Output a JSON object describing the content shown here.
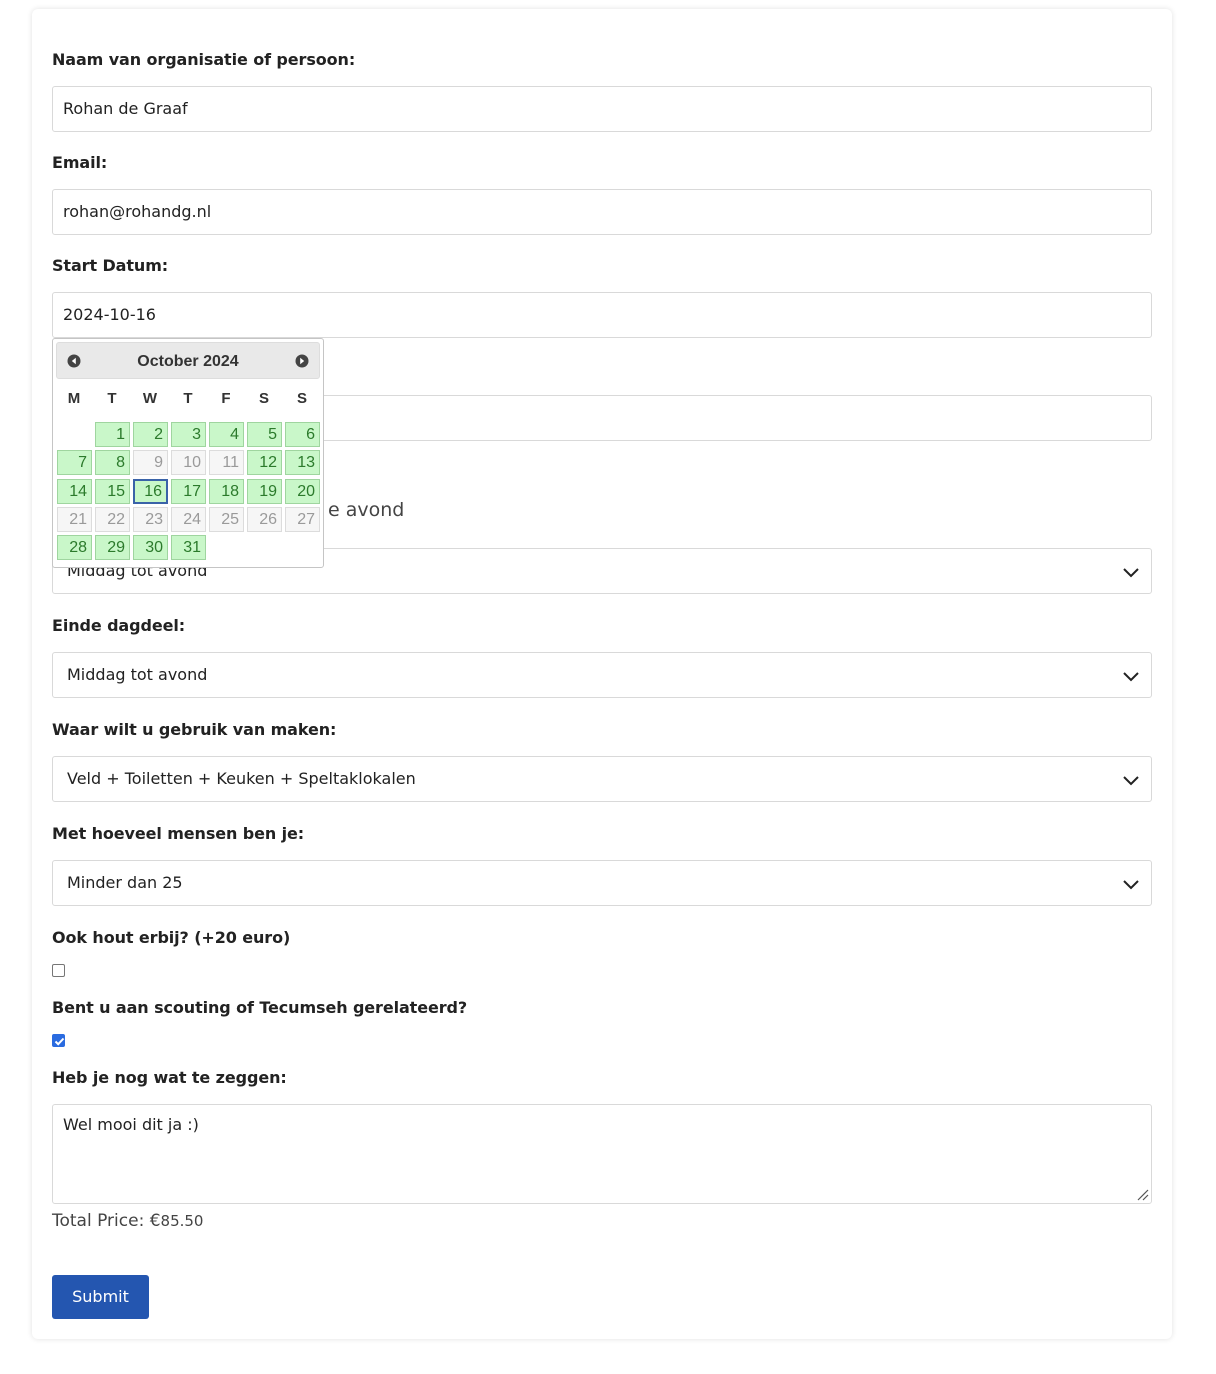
{
  "form": {
    "name_label": "Naam van organisatie of persoon:",
    "name_value": "Rohan de Graaf",
    "email_label": "Email:",
    "email_value": "rohan@rohandg.nl",
    "start_date_label": "Start Datum:",
    "start_date_value": "2024-10-16",
    "behind_text": "e avond",
    "start_part_value": "Middag tot avond",
    "end_part_label": "Einde dagdeel:",
    "end_part_value": "Middag tot avond",
    "usage_label": "Waar wilt u gebruik van maken:",
    "usage_value": "Veld + Toiletten + Keuken + Speltaklokalen",
    "people_label": "Met hoeveel mensen ben je:",
    "people_value": "Minder dan 25",
    "wood_label": "Ook hout erbij? (+20 euro)",
    "wood_checked": false,
    "scouting_label": "Bent u aan scouting of Tecumseh gerelateerd?",
    "scouting_checked": true,
    "comment_label": "Heb je nog wat te zeggen:",
    "comment_value": "Wel mooi dit ja :)",
    "price_label": "Total Price: €",
    "price_value": "85.50",
    "submit_label": "Submit"
  },
  "datepicker": {
    "title": "October 2024",
    "weekdays": [
      "M",
      "T",
      "W",
      "T",
      "F",
      "S",
      "S"
    ],
    "first_weekday_offset": 1,
    "days": [
      {
        "d": "1",
        "s": "avail"
      },
      {
        "d": "2",
        "s": "avail"
      },
      {
        "d": "3",
        "s": "avail"
      },
      {
        "d": "4",
        "s": "avail"
      },
      {
        "d": "5",
        "s": "avail"
      },
      {
        "d": "6",
        "s": "avail"
      },
      {
        "d": "7",
        "s": "avail"
      },
      {
        "d": "8",
        "s": "avail"
      },
      {
        "d": "9",
        "s": "unavail"
      },
      {
        "d": "10",
        "s": "unavail"
      },
      {
        "d": "11",
        "s": "unavail"
      },
      {
        "d": "12",
        "s": "avail"
      },
      {
        "d": "13",
        "s": "avail"
      },
      {
        "d": "14",
        "s": "avail"
      },
      {
        "d": "15",
        "s": "avail"
      },
      {
        "d": "16",
        "s": "selected"
      },
      {
        "d": "17",
        "s": "avail"
      },
      {
        "d": "18",
        "s": "avail"
      },
      {
        "d": "19",
        "s": "avail"
      },
      {
        "d": "20",
        "s": "avail"
      },
      {
        "d": "21",
        "s": "unavail"
      },
      {
        "d": "22",
        "s": "unavail"
      },
      {
        "d": "23",
        "s": "unavail"
      },
      {
        "d": "24",
        "s": "unavail"
      },
      {
        "d": "25",
        "s": "unavail"
      },
      {
        "d": "26",
        "s": "unavail"
      },
      {
        "d": "27",
        "s": "unavail"
      },
      {
        "d": "28",
        "s": "avail"
      },
      {
        "d": "29",
        "s": "avail"
      },
      {
        "d": "30",
        "s": "avail"
      },
      {
        "d": "31",
        "s": "avail"
      }
    ],
    "colors": {
      "available": "#c9f7c9",
      "selected_border": "#3a63a8"
    }
  },
  "icons": {
    "select_arrow": "chevron-down-icon",
    "prev": "circle-triangle-left-icon",
    "next": "circle-triangle-right-icon"
  },
  "colors": {
    "submit": "#2456b0",
    "checkbox": "#2a6be0"
  }
}
